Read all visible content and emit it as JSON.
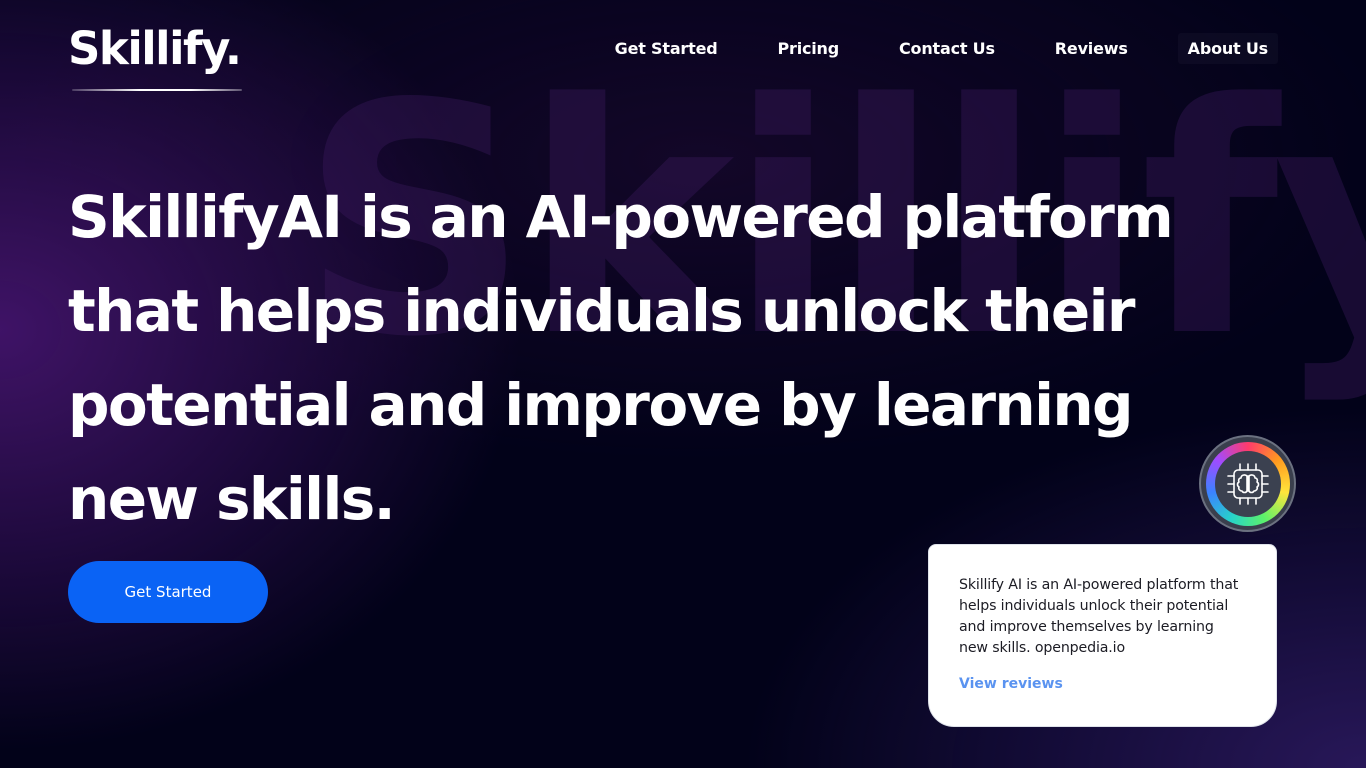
{
  "watermark": "Skillify",
  "header": {
    "logo": "Skillify.",
    "nav": [
      {
        "label": "Get Started"
      },
      {
        "label": "Pricing"
      },
      {
        "label": "Contact Us"
      },
      {
        "label": "Reviews"
      },
      {
        "label": "About Us"
      }
    ]
  },
  "hero": {
    "title": "SkillifyAI is an AI-powered platform that helps individuals unlock their potential and improve by learning new skills.",
    "cta_label": "Get Started"
  },
  "badge": {
    "icon": "brain-chip-icon"
  },
  "card": {
    "text": "Skillify AI is an AI-powered platform that helps individuals unlock their potential and improve themselves by learning new skills. openpedia.io",
    "link_label": "View reviews"
  },
  "colors": {
    "background": "#020219",
    "accent": "#0a63f5",
    "link": "#5a93f0"
  }
}
